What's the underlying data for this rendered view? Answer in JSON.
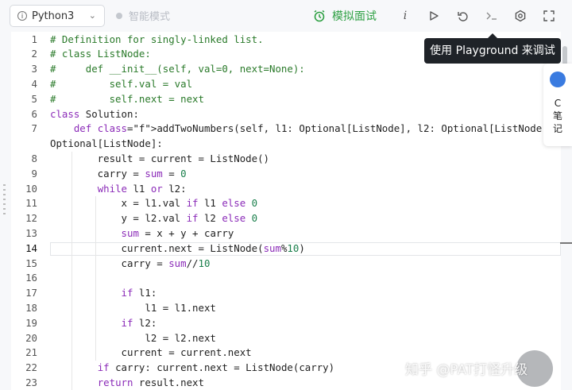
{
  "toolbar": {
    "language": "Python3",
    "smart_mode": "智能模式",
    "mock_interview": "模拟面试",
    "icons": [
      "info-icon",
      "run-icon",
      "reset-icon",
      "console-icon",
      "settings-icon",
      "fullscreen-icon"
    ],
    "info_glyph": "i"
  },
  "tooltip": {
    "text": "使用 Playground 来调试"
  },
  "notes": {
    "text": "C 笔 记"
  },
  "watermark": "知乎 @PAT打怪升级",
  "colors": {
    "accent_green": "#2ea043",
    "comment": "#2a7a2a",
    "keyword": "#8b2bb8",
    "tooltip_bg": "#1f2328"
  },
  "editor": {
    "current_line": 14,
    "lines": [
      {
        "n": "1",
        "t": "# Definition for singly-linked list."
      },
      {
        "n": "2",
        "t": "# class ListNode:"
      },
      {
        "n": "3",
        "t": "#     def __init__(self, val=0, next=None):"
      },
      {
        "n": "4",
        "t": "#         self.val = val"
      },
      {
        "n": "5",
        "t": "#         self.next = next"
      },
      {
        "n": "6",
        "t": "class Solution:"
      },
      {
        "n": "7",
        "t": "    def addTwoNumbers(self, l1: Optional[ListNode], l2: Optional[ListNode]) ->"
      },
      {
        "n": "",
        "t": "Optional[ListNode]:"
      },
      {
        "n": "8",
        "t": "        result = current = ListNode()"
      },
      {
        "n": "9",
        "t": "        carry = sum = 0"
      },
      {
        "n": "10",
        "t": "        while l1 or l2:"
      },
      {
        "n": "11",
        "t": "            x = l1.val if l1 else 0"
      },
      {
        "n": "12",
        "t": "            y = l2.val if l2 else 0"
      },
      {
        "n": "13",
        "t": "            sum = x + y + carry"
      },
      {
        "n": "14",
        "t": "            current.next = ListNode(sum%10)"
      },
      {
        "n": "15",
        "t": "            carry = sum//10"
      },
      {
        "n": "16",
        "t": ""
      },
      {
        "n": "17",
        "t": "            if l1:"
      },
      {
        "n": "18",
        "t": "                l1 = l1.next"
      },
      {
        "n": "19",
        "t": "            if l2:"
      },
      {
        "n": "20",
        "t": "                l2 = l2.next"
      },
      {
        "n": "21",
        "t": "            current = current.next"
      },
      {
        "n": "22",
        "t": "        if carry: current.next = ListNode(carry)"
      },
      {
        "n": "23",
        "t": "        return result.next"
      }
    ]
  }
}
